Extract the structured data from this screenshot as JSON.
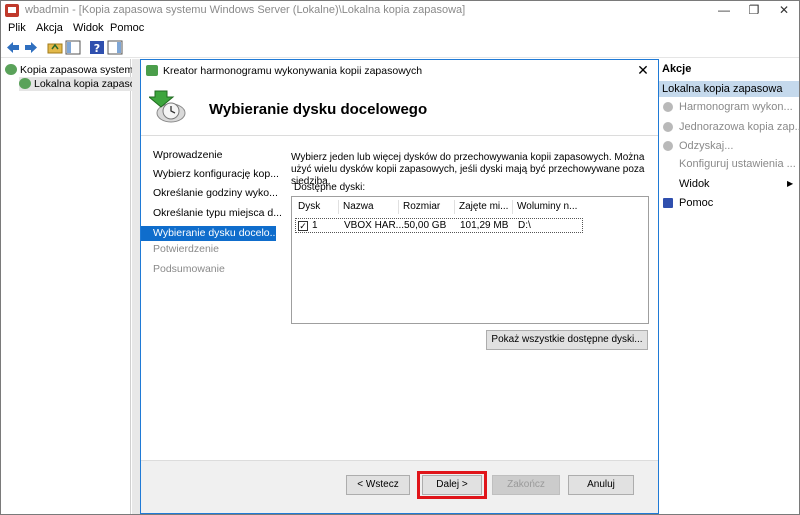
{
  "window": {
    "title": "wbadmin - [Kopia zapasowa systemu Windows Server (Lokalne)\\Lokalna kopia zapasowa]",
    "minimize": "—",
    "maximize": "❐",
    "close": "✕"
  },
  "menu": [
    "Plik",
    "Akcja",
    "Widok",
    "Pomoc"
  ],
  "tree": {
    "root": "Kopia zapasowa systemu W",
    "child": "Lokalna kopia zapasow"
  },
  "actions_panel": {
    "header": "Akcje",
    "section": "Lokalna kopia zapasowa",
    "items": [
      {
        "label": "Harmonogram wykon...",
        "enabled": false
      },
      {
        "label": "Jednorazowa kopia zap...",
        "enabled": false
      },
      {
        "label": "Odzyskaj...",
        "enabled": false
      },
      {
        "label": "Konfiguruj ustawienia ...",
        "enabled": false
      },
      {
        "label": "Widok",
        "enabled": true,
        "submenu": "▶"
      },
      {
        "label": "Pomoc",
        "enabled": true
      }
    ]
  },
  "dialog": {
    "title": "Kreator harmonogramu wykonywania kopii zapasowych",
    "close": "✕",
    "heading": "Wybieranie dysku docelowego",
    "steps": [
      {
        "label": "Wprowadzenie",
        "state": "normal"
      },
      {
        "label": "Wybierz konfigurację kop...",
        "state": "normal"
      },
      {
        "label": "Określanie godziny wyko...",
        "state": "normal"
      },
      {
        "label": "Określanie typu miejsca d...",
        "state": "normal"
      },
      {
        "label": "Wybieranie dysku docelo...",
        "state": "active"
      },
      {
        "label": "Potwierdzenie",
        "state": "disabled"
      },
      {
        "label": "Podsumowanie",
        "state": "disabled"
      }
    ],
    "description": "Wybierz jeden lub więcej dysków do przechowywania kopii zapasowych. Można użyć wielu dysków kopii zapasowych, jeśli dyski mają być przechowywane poza siedzibą.",
    "available_label": "Dostępne dyski:",
    "columns": [
      "Dysk",
      "Nazwa",
      "Rozmiar",
      "Zajęte mi...",
      "Woluminy n..."
    ],
    "rows": [
      {
        "checked": true,
        "disk": "1",
        "name": "VBOX HAR...",
        "size": "50,00 GB",
        "used": "101,29 MB",
        "volumes": "D:\\"
      }
    ],
    "show_all_button": "Pokaż wszystkie dostępne dyski...",
    "buttons": {
      "back": "< Wstecz",
      "next": "Dalej >",
      "finish": "Zakończ",
      "cancel": "Anuluj"
    }
  },
  "colors": {
    "accent": "#0f6dcc",
    "highlight_border": "#e0151a",
    "section_bg": "#c5d9ec"
  }
}
